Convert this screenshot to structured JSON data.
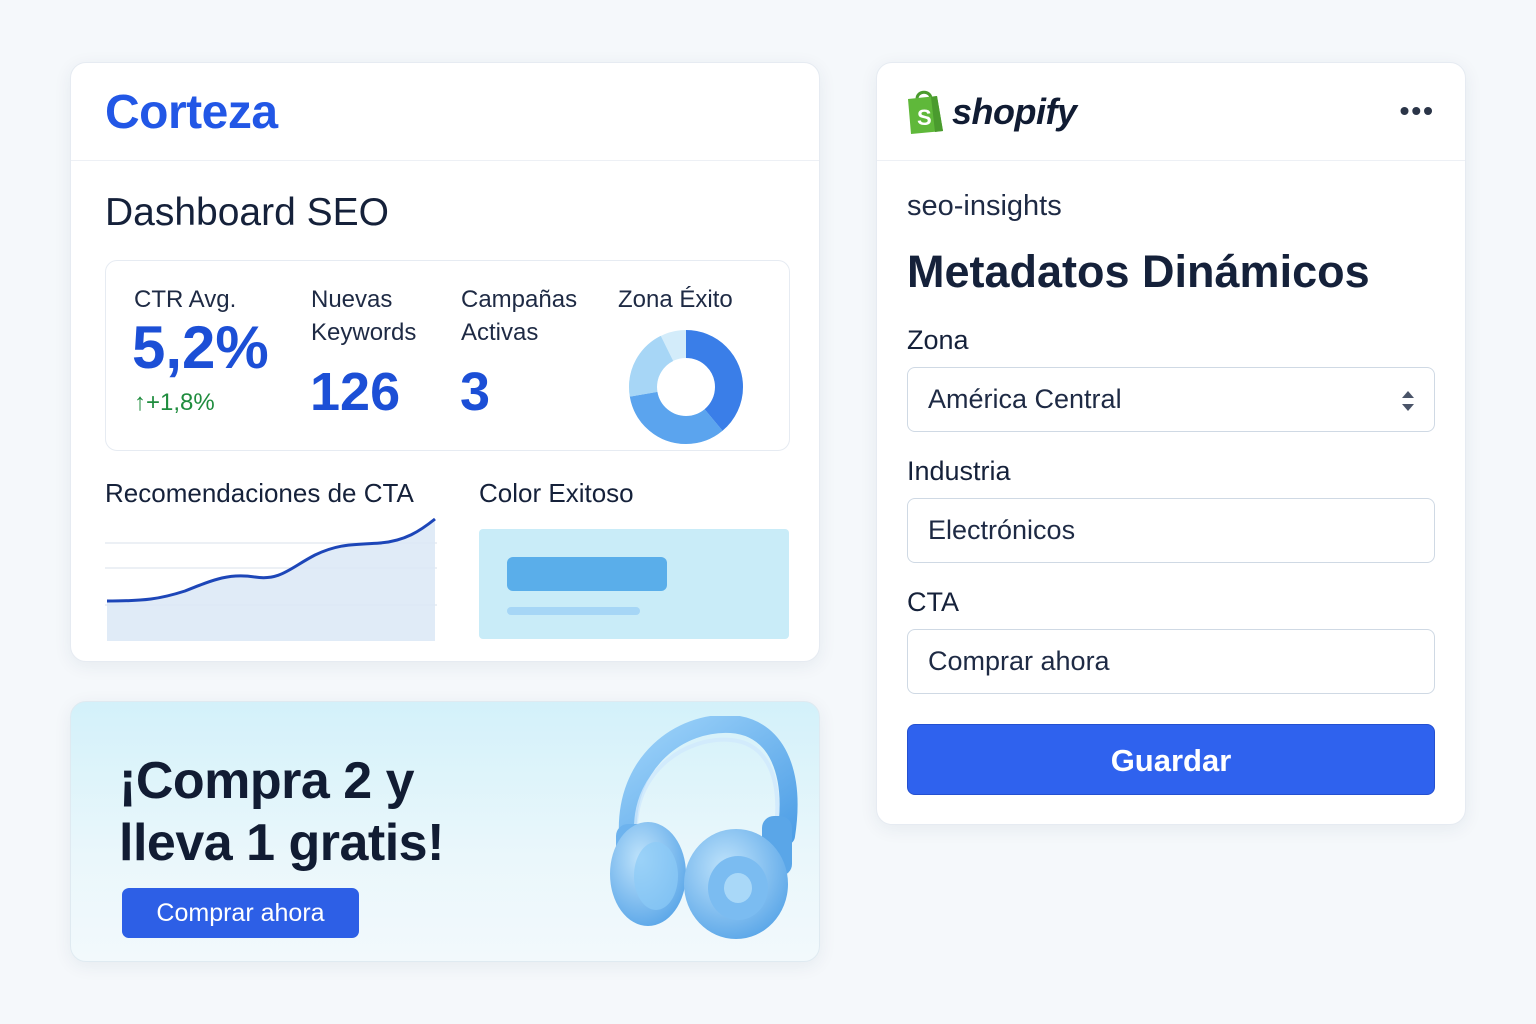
{
  "dashboard": {
    "brand": "Corteza",
    "title": "Dashboard SEO",
    "stats": {
      "ctr_label": "CTR Avg.",
      "ctr_value": "5,2%",
      "ctr_delta": "+1,8%",
      "keywords_label_line1": "Nuevas",
      "keywords_label_line2": "Keywords",
      "keywords_value": "126",
      "campaigns_label_line1": "Campañas",
      "campaigns_label_line2": "Activas",
      "campaigns_value": "3",
      "zone_label": "Zona Éxito"
    },
    "cta_recommendations_label": "Recomendaciones de CTA",
    "color_label": "Color Exitoso",
    "colors": {
      "accent": "#2257e6",
      "positive": "#1f8c3e"
    }
  },
  "promo": {
    "title_line1": "¡Compra 2 y",
    "title_line2": "lleva 1 gratis!",
    "button_label": "Comprar ahora"
  },
  "shopify": {
    "brand": "shopify",
    "app_name": "seo-insights",
    "title": "Metadatos Dinámicos",
    "zona_label": "Zona",
    "zona_value": "América Central",
    "industria_label": "Industria",
    "industria_value": "Electrónicos",
    "cta_label": "CTA",
    "cta_value": "Comprar ahora",
    "save_label": "Guardar",
    "colors": {
      "primary": "#2f62ee",
      "brand_green": "#5fb83a"
    }
  }
}
